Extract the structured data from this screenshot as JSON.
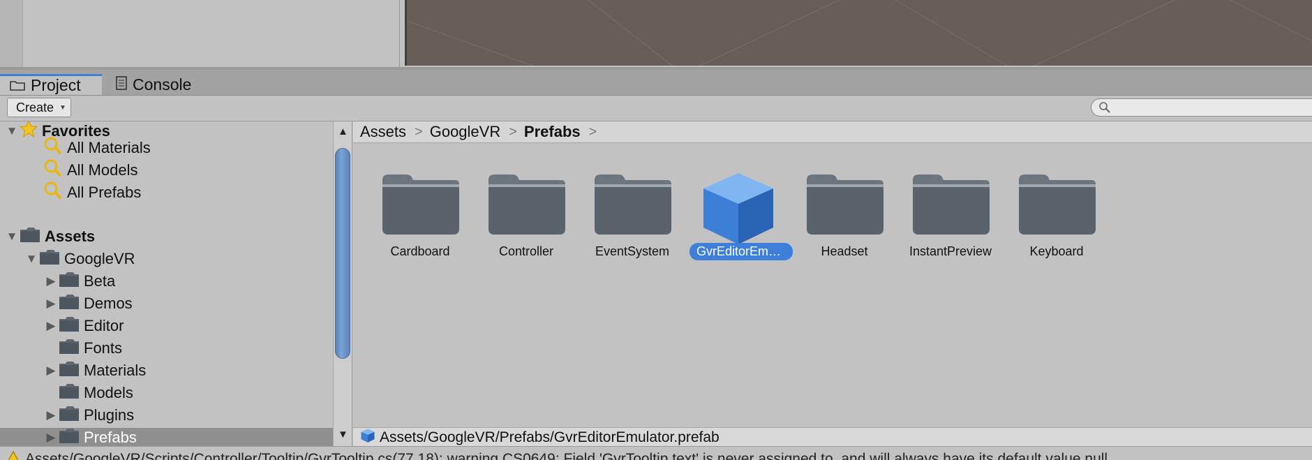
{
  "tabs": [
    {
      "label": "Project",
      "icon": "folder-icon",
      "active": true
    },
    {
      "label": "Console",
      "icon": "console-icon",
      "active": false
    }
  ],
  "toolbar": {
    "create_label": "Create",
    "search_placeholder": ""
  },
  "favorites": {
    "label": "Favorites",
    "items": [
      {
        "label": "All Materials"
      },
      {
        "label": "All Models"
      },
      {
        "label": "All Prefabs"
      }
    ]
  },
  "assets": {
    "label": "Assets",
    "googlevr": {
      "label": "GoogleVR",
      "children": [
        {
          "label": "Beta",
          "expandable": true
        },
        {
          "label": "Demos",
          "expandable": true
        },
        {
          "label": "Editor",
          "expandable": true
        },
        {
          "label": "Fonts",
          "expandable": false
        },
        {
          "label": "Materials",
          "expandable": true
        },
        {
          "label": "Models",
          "expandable": false
        },
        {
          "label": "Plugins",
          "expandable": true
        },
        {
          "label": "Prefabs",
          "expandable": true,
          "selected": true
        }
      ]
    }
  },
  "breadcrumb": {
    "items": [
      "Assets",
      "GoogleVR",
      "Prefabs"
    ]
  },
  "grid_items": [
    {
      "label": "Cardboard",
      "type": "folder"
    },
    {
      "label": "Controller",
      "type": "folder"
    },
    {
      "label": "EventSystem",
      "type": "folder"
    },
    {
      "label": "GvrEditorEmu…",
      "type": "prefab",
      "selected": true
    },
    {
      "label": "Headset",
      "type": "folder"
    },
    {
      "label": "InstantPreview",
      "type": "folder"
    },
    {
      "label": "Keyboard",
      "type": "folder"
    }
  ],
  "path_bar": {
    "path": "Assets/GoogleVR/Prefabs/GvrEditorEmulator.prefab"
  },
  "warning": {
    "text": "Assets/GoogleVR/Scripts/Controller/Tooltip/GvrTooltip.cs(77,18): warning CS0649: Field 'GvrTooltip.text' is never assigned to, and will always have its default value null"
  },
  "colors": {
    "selection": "#3d7fdb",
    "scene_bg": "#675e57",
    "panel_bg": "#c2c2c2",
    "folder": "#5c666e"
  }
}
